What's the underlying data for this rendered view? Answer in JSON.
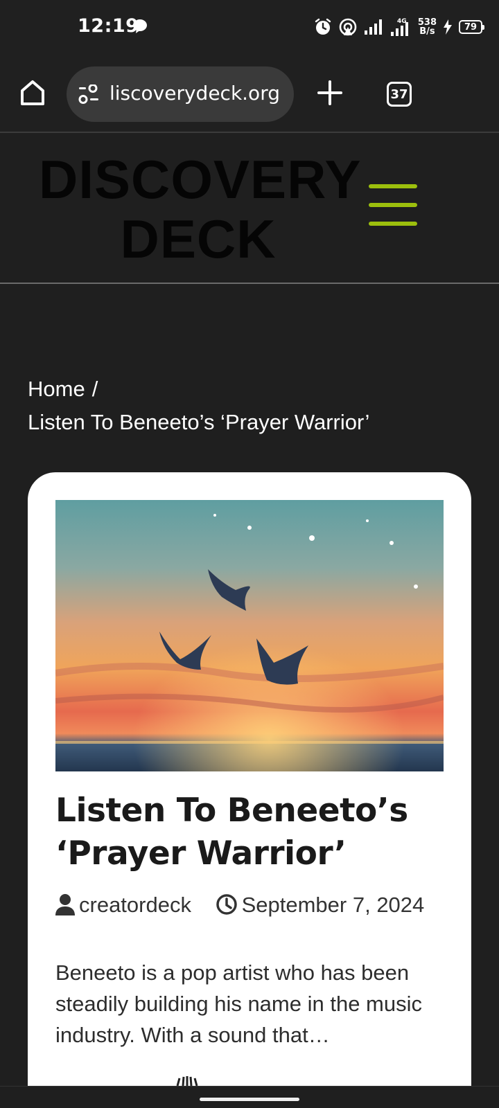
{
  "status_bar": {
    "time": "12:19",
    "network_speed_value": "538",
    "network_speed_unit": "B/s",
    "battery": "79",
    "network_type": "4G"
  },
  "browser": {
    "url": "liscoverydeck.org",
    "tab_count": "37"
  },
  "site": {
    "logo_line1": "DISCOVERY",
    "logo_line2": "DECK",
    "menu_color": "#9cbf0d"
  },
  "breadcrumb": {
    "home": "Home",
    "separator": "/",
    "current": "Listen To Beneeto’s ‘Prayer Warrior’"
  },
  "article": {
    "title": "Listen To Beneeto’s ‘Prayer Warrior’",
    "author": "creatordeck",
    "date": "September 7, 2024",
    "excerpt": "Beneeto is a pop artist who has been steadily building his name in the music industry. With a sound that…"
  }
}
